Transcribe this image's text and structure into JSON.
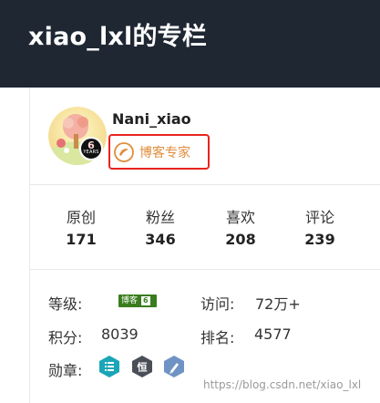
{
  "header": {
    "title": "xiao_lxl的专栏"
  },
  "profile": {
    "username": "Nani_xiao",
    "years": "6",
    "years_label": "YEARS",
    "expert_label": "博客专家"
  },
  "stats": [
    {
      "label": "原创",
      "value": "171"
    },
    {
      "label": "粉丝",
      "value": "346"
    },
    {
      "label": "喜欢",
      "value": "208"
    },
    {
      "label": "评论",
      "value": "239"
    }
  ],
  "info": {
    "level_label": "等级:",
    "level_badge_text": "博客",
    "level_badge_num": "6",
    "visits_label": "访问:",
    "visits_value": "72万+",
    "points_label": "积分:",
    "points_value": "8039",
    "rank_label": "排名:",
    "rank_value": "4577",
    "medals_label": "勋章:"
  },
  "medals": [
    {
      "name": "list-medal",
      "glyph": "☰",
      "color": "#1aa6b8"
    },
    {
      "name": "persistence-medal",
      "glyph": "恒",
      "color": "#4a4f57"
    },
    {
      "name": "pen-medal",
      "glyph": "✎",
      "color": "#6f93c4"
    }
  ],
  "watermark": "https://blog.csdn.net/xiao_lxl",
  "colors": {
    "header_bg": "#1f2733",
    "expert_border": "#e8231d",
    "expert_text": "#e08d3c",
    "level_badge": "#3a7d1f"
  }
}
